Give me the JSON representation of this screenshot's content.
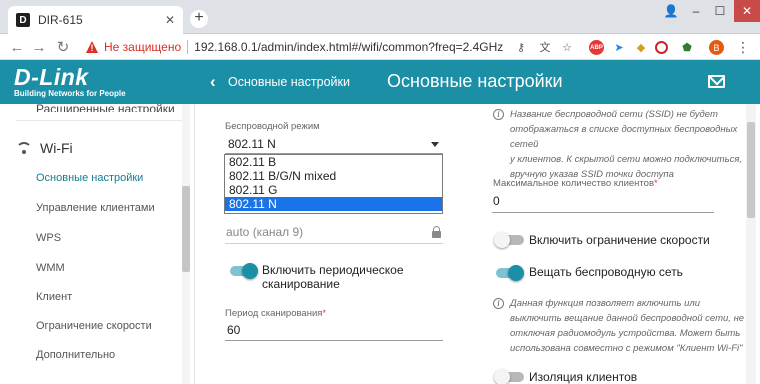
{
  "browser": {
    "tab_title": "DIR-615",
    "favicon_letter": "D",
    "insecure_text": "Не защищено",
    "url": "192.168.0.1/admin/index.html#/wifi/common?freq=2.4GHz",
    "abp_label": "ABP",
    "profile_letter": "B"
  },
  "header": {
    "logo": "D-Link",
    "tagline": "Building Networks for People",
    "back_label": "Основные настройки",
    "title": "Основные настройки",
    "color": "#1b8fa6"
  },
  "sidebar": {
    "prev_item": "Расширенные настройки",
    "section": "Wi-Fi",
    "items": [
      {
        "label": "Основные настройки",
        "active": true
      },
      {
        "label": "Управление клиентами"
      },
      {
        "label": "WPS"
      },
      {
        "label": "WMM"
      },
      {
        "label": "Клиент"
      },
      {
        "label": "Ограничение скорости"
      },
      {
        "label": "Дополнительно"
      }
    ]
  },
  "form": {
    "wireless_mode_label": "Беспроводной режим",
    "wireless_mode_value": "802.11 N",
    "wireless_mode_options": [
      "802.11 B",
      "802.11 B/G/N mixed",
      "802.11 G",
      "802.11 N"
    ],
    "channel_value": "auto (канал 9)",
    "periodic_scan_label_1": "Включить периодическое",
    "periodic_scan_label_2": "сканирование",
    "periodic_scan_on": true,
    "scan_period_label": "Период сканирования",
    "scan_period_value": "60",
    "required_mark": "*"
  },
  "right": {
    "ssid_note": [
      "Название беспроводной сети (SSID) не будет",
      "отображаться в списке доступных беспроводных сетей",
      "у клиентов. К скрытой сети можно подключиться,",
      "вручную указав SSID точки доступа"
    ],
    "max_clients_label": "Максимальное количество клиентов",
    "max_clients_value": "0",
    "speed_limit_label": "Включить ограничение скорости",
    "speed_limit_on": false,
    "broadcast_label": "Вещать беспроводную сеть",
    "broadcast_on": true,
    "broadcast_note": [
      "Данная функция позволяет включить или",
      "выключить вещание данной беспроводной сети, не",
      "отключая радиомодуль устройства. Может быть",
      "использована совместно с режимом \"Клиент Wi-Fi\""
    ],
    "isolation_label": "Изоляция клиентов"
  }
}
